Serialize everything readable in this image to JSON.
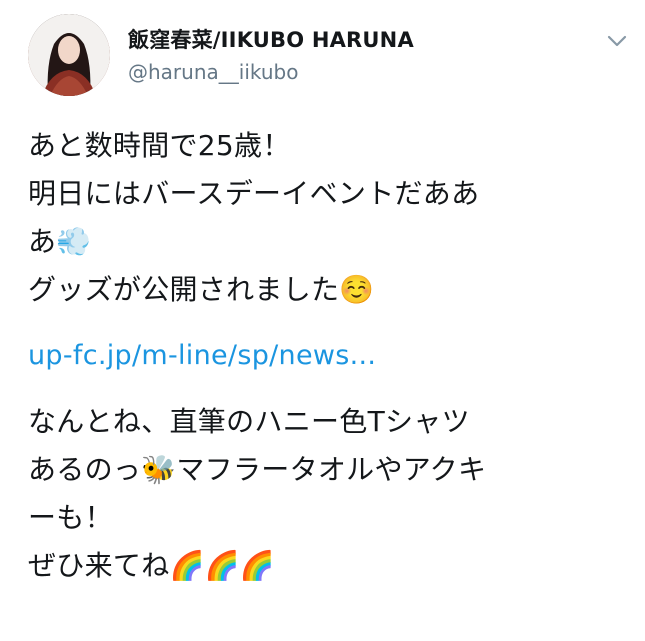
{
  "user": {
    "display_name": "飯窪春菜/IIKUBO HARUNA",
    "handle": "@haruna__iikubo"
  },
  "tweet": {
    "line1": "あと数時間で25歳！",
    "line2": "明日にはバースデーイベントだああ",
    "line3": "あ💨",
    "line4": "グッズが公開されました☺️",
    "link": "up-fc.jp/m-line/sp/news...",
    "line5": "なんとね、直筆のハニー色Tシャツ",
    "line6": "あるのっ🐝マフラータオルやアクキ",
    "line7": "ーも！",
    "line8": "ぜひ来てね🌈🌈🌈"
  },
  "colors": {
    "link": "#1b95e0",
    "handle": "#657786",
    "text": "#14171a"
  },
  "icons": {
    "more": "chevron-down-icon"
  }
}
